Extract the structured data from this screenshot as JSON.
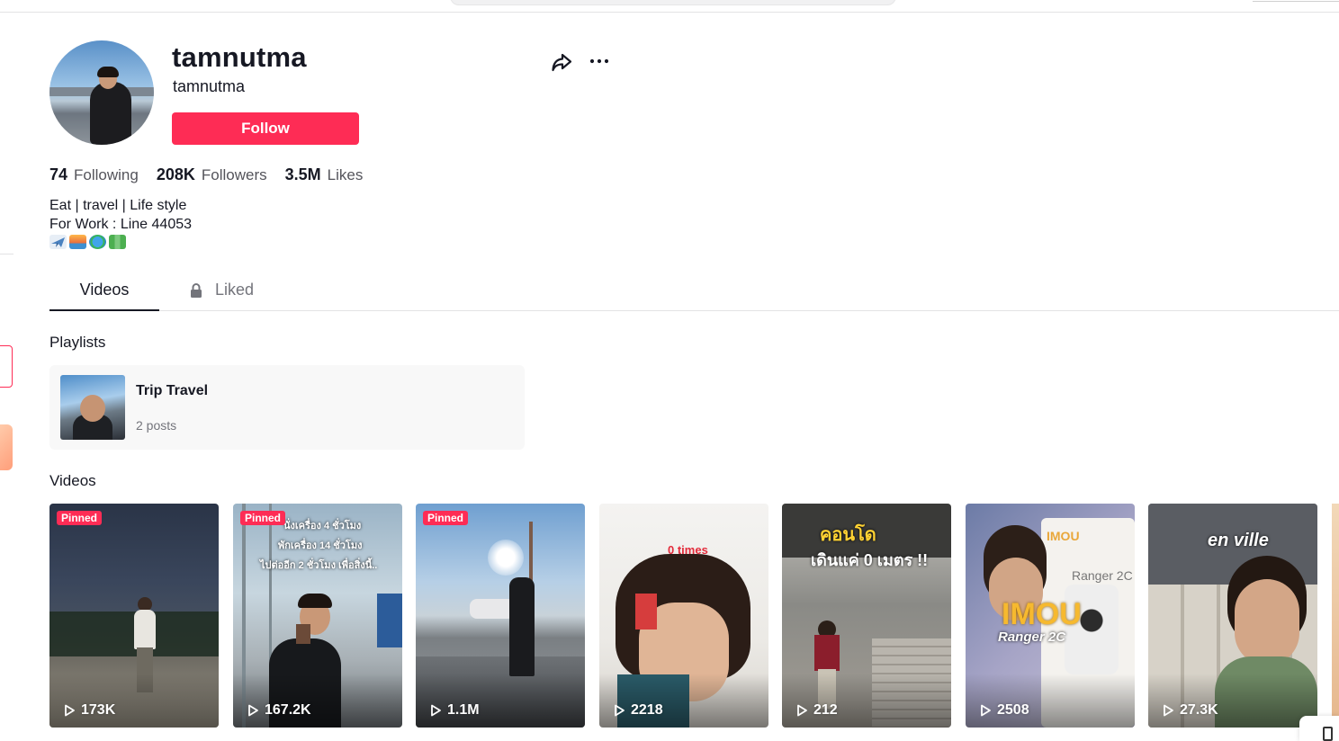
{
  "profile": {
    "username": "tamnutma",
    "nickname": "tamnutma",
    "follow_label": "Follow",
    "stats": [
      {
        "value": "74",
        "label": "Following"
      },
      {
        "value": "208K",
        "label": "Followers"
      },
      {
        "value": "3.5M",
        "label": "Likes"
      }
    ],
    "bio_lines": [
      "Eat | travel | Life style",
      "For Work : Line 44053"
    ],
    "bio_emojis": [
      "airplane-emoji",
      "sunrise-picture-emoji",
      "globe-emoji",
      "map-emoji"
    ]
  },
  "tabs": [
    {
      "label": "Videos",
      "active": true
    },
    {
      "label": "Liked",
      "active": false,
      "icon": "lock-icon"
    }
  ],
  "playlists": {
    "title": "Playlists",
    "items": [
      {
        "name": "Trip Travel",
        "count": "2 posts"
      }
    ]
  },
  "videos": {
    "title": "Videos",
    "pinned_label": "Pinned",
    "items": [
      {
        "views": "173K",
        "pinned": true
      },
      {
        "views": "167.2K",
        "pinned": true,
        "overlay": [
          "นั่งเครื่อง 4 ชั่วโมง",
          "พักเครื่อง 14 ชั่วโมง",
          "ไปต่ออีก 2 ชั่วโมง เพื่อสิ่งนี้.."
        ]
      },
      {
        "views": "1.1M",
        "pinned": true
      },
      {
        "views": "2218",
        "pinned": false,
        "overlay": [
          "0 times"
        ]
      },
      {
        "views": "212",
        "pinned": false,
        "overlay": [
          "คอนโด",
          "เดินแค่ 0 เมตร !!"
        ]
      },
      {
        "views": "2508",
        "pinned": false,
        "overlay": [
          "IMOU",
          "Ranger 2C",
          "IMOU",
          "Ranger 2C"
        ]
      },
      {
        "views": "27.3K",
        "pinned": false,
        "overlay": [
          "en ville"
        ]
      }
    ]
  },
  "colors": {
    "accent": "#fe2c55",
    "text": "#161823",
    "muted": "#73747b"
  }
}
